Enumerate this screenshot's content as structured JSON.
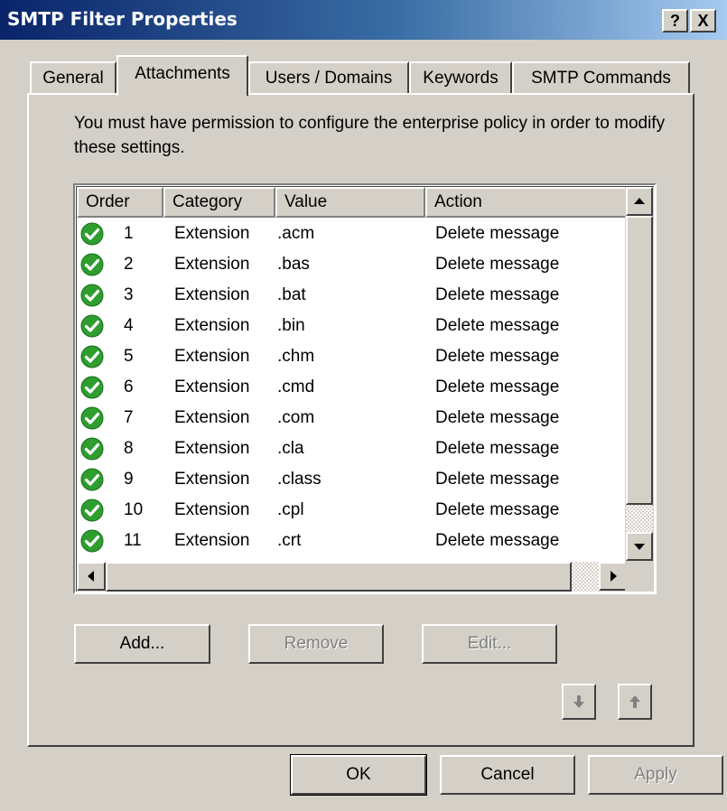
{
  "window": {
    "title": "SMTP Filter Properties",
    "help_label": "?",
    "close_label": "X"
  },
  "tabs": [
    {
      "label": "General",
      "active": false
    },
    {
      "label": "Attachments",
      "active": true
    },
    {
      "label": "Users / Domains",
      "active": false
    },
    {
      "label": "Keywords",
      "active": false
    },
    {
      "label": "SMTP Commands",
      "active": false
    }
  ],
  "info_text": "You must have permission to configure the enterprise policy in order to modify these settings.",
  "list": {
    "columns": [
      "Order",
      "Category",
      "Value",
      "Action"
    ],
    "rows": [
      {
        "order": "1",
        "category": "Extension",
        "value": ".acm",
        "action": "Delete message",
        "icon": "green-check-icon"
      },
      {
        "order": "2",
        "category": "Extension",
        "value": ".bas",
        "action": "Delete message",
        "icon": "green-check-icon"
      },
      {
        "order": "3",
        "category": "Extension",
        "value": ".bat",
        "action": "Delete message",
        "icon": "green-check-icon"
      },
      {
        "order": "4",
        "category": "Extension",
        "value": ".bin",
        "action": "Delete message",
        "icon": "green-check-icon"
      },
      {
        "order": "5",
        "category": "Extension",
        "value": ".chm",
        "action": "Delete message",
        "icon": "green-check-icon"
      },
      {
        "order": "6",
        "category": "Extension",
        "value": ".cmd",
        "action": "Delete message",
        "icon": "green-check-icon"
      },
      {
        "order": "7",
        "category": "Extension",
        "value": ".com",
        "action": "Delete message",
        "icon": "green-check-icon"
      },
      {
        "order": "8",
        "category": "Extension",
        "value": ".cla",
        "action": "Delete message",
        "icon": "green-check-icon"
      },
      {
        "order": "9",
        "category": "Extension",
        "value": ".class",
        "action": "Delete message",
        "icon": "green-check-icon"
      },
      {
        "order": "10",
        "category": "Extension",
        "value": ".cpl",
        "action": "Delete message",
        "icon": "green-check-icon"
      },
      {
        "order": "11",
        "category": "Extension",
        "value": ".crt",
        "action": "Delete message",
        "icon": "green-check-icon"
      }
    ]
  },
  "buttons": {
    "add": "Add...",
    "remove": "Remove",
    "edit": "Edit...",
    "ok": "OK",
    "cancel": "Cancel",
    "apply": "Apply"
  },
  "colors": {
    "title_bar_start": "#0a246a",
    "title_bar_end": "#a6caf0",
    "face": "#d4d0c8",
    "check_green": "#2e9e2e",
    "disabled_text": "#808080"
  }
}
